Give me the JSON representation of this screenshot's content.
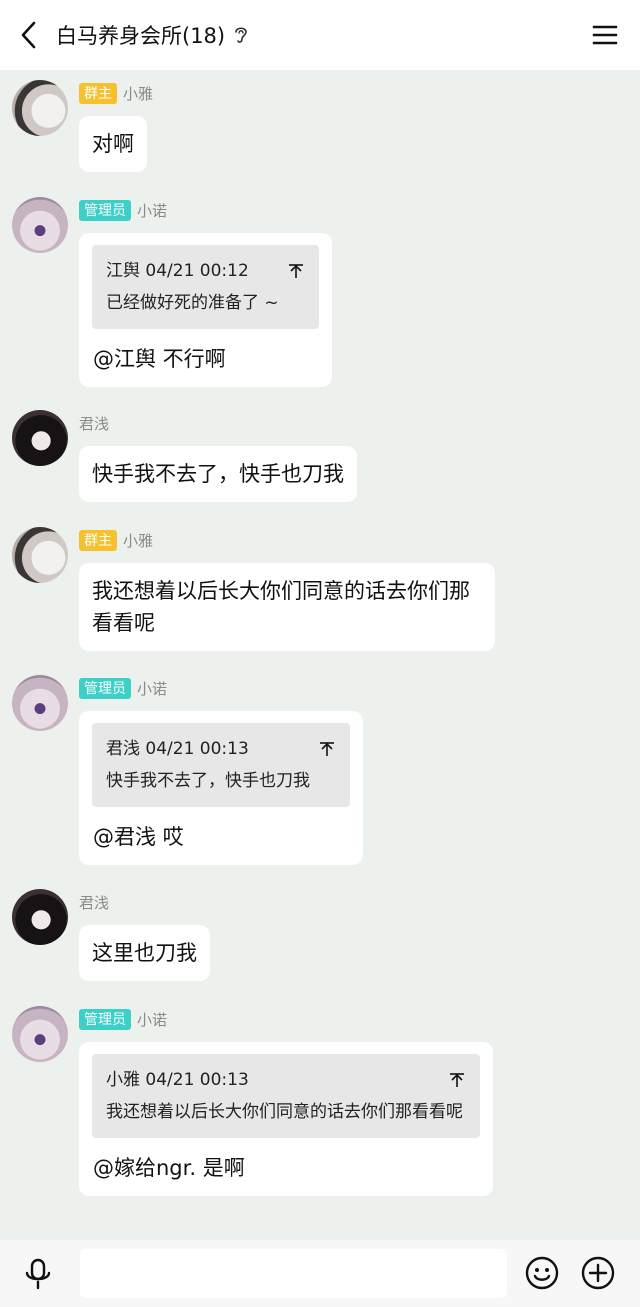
{
  "header": {
    "title": "白马养身会所(18)",
    "back_icon": "chevron-left-icon",
    "ear_icon": "ear-icon",
    "menu_icon": "hamburger-menu-icon"
  },
  "messages": [
    {
      "role": "群主",
      "name": "小雅",
      "text": "对啊"
    },
    {
      "role": "管理员",
      "name": "小诺",
      "quote_head": "江舆 04/21 00:12",
      "quote_text": "已经做好死的准备了 ~",
      "text": "@江舆 不行啊"
    },
    {
      "role": "",
      "name": "君浅",
      "text": "快手我不去了，快手也刀我"
    },
    {
      "role": "群主",
      "name": "小雅",
      "text": "我还想着以后长大你们同意的话去你们那看看呢"
    },
    {
      "role": "管理员",
      "name": "小诺",
      "quote_head": "君浅 04/21 00:13",
      "quote_text": "快手我不去了，快手也刀我",
      "text": "@君浅 哎"
    },
    {
      "role": "",
      "name": "君浅",
      "text": "这里也刀我"
    },
    {
      "role": "管理员",
      "name": "小诺",
      "quote_head": "小雅 04/21 00:13",
      "quote_text": "我还想着以后长大你们同意的话去你们那看看呢",
      "text": "@嫁给ngr. 是啊"
    }
  ],
  "bottom": {
    "input_value": "",
    "mic_icon": "microphone-icon",
    "emoji_icon": "smiley-icon",
    "plus_icon": "plus-circle-icon"
  },
  "colors": {
    "owner_badge": "#f5c12f",
    "admin_badge": "#3dd0c9",
    "chat_bg": "#edf1ed"
  }
}
